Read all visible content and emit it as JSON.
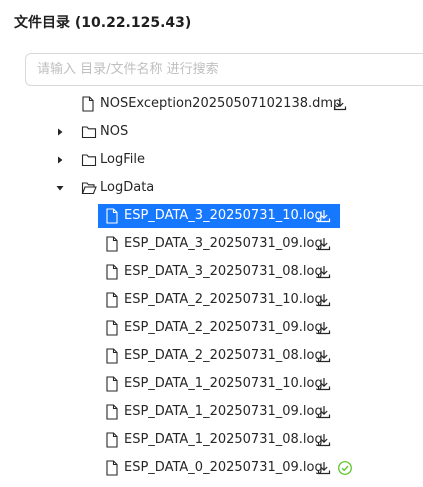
{
  "panel": {
    "title": "文件目录 (10.22.125.43)"
  },
  "search": {
    "placeholder": "请输入 目录/文件名称 进行搜索",
    "value": ""
  },
  "tree": {
    "items": [
      {
        "type": "file",
        "label": "NOSException20250507102138.dmp",
        "indent": 1,
        "download": true
      },
      {
        "type": "folder",
        "label": "NOS",
        "expanded": false
      },
      {
        "type": "folder",
        "label": "LogFile",
        "expanded": false
      },
      {
        "type": "folder",
        "label": "LogData",
        "expanded": true
      },
      {
        "type": "file",
        "label": "ESP_DATA_3_20250731_10.log",
        "indent": 2,
        "download": true,
        "selected": true
      },
      {
        "type": "file",
        "label": "ESP_DATA_3_20250731_09.log",
        "indent": 2,
        "download": true
      },
      {
        "type": "file",
        "label": "ESP_DATA_3_20250731_08.log",
        "indent": 2,
        "download": true
      },
      {
        "type": "file",
        "label": "ESP_DATA_2_20250731_10.log",
        "indent": 2,
        "download": true
      },
      {
        "type": "file",
        "label": "ESP_DATA_2_20250731_09.log",
        "indent": 2,
        "download": true
      },
      {
        "type": "file",
        "label": "ESP_DATA_2_20250731_08.log",
        "indent": 2,
        "download": true
      },
      {
        "type": "file",
        "label": "ESP_DATA_1_20250731_10.log",
        "indent": 2,
        "download": true
      },
      {
        "type": "file",
        "label": "ESP_DATA_1_20250731_09.log",
        "indent": 2,
        "download": true
      },
      {
        "type": "file",
        "label": "ESP_DATA_1_20250731_08.log",
        "indent": 2,
        "download": true
      },
      {
        "type": "file",
        "label": "ESP_DATA_0_20250731_09.log",
        "indent": 2,
        "download": true,
        "status": "check-circle-icon"
      }
    ]
  },
  "colors": {
    "selected_bg": "#1677ff",
    "success": "#52c41a"
  }
}
